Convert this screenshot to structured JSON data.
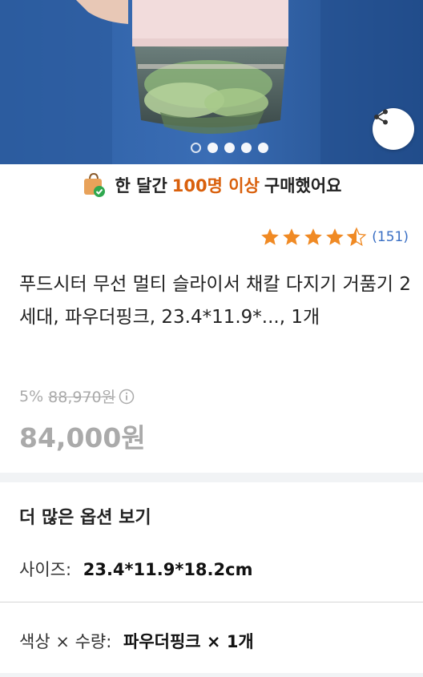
{
  "hero": {
    "share_icon": "share-icon",
    "carousel_dots": 5,
    "active_dot": 0
  },
  "banner": {
    "icon": "shopping-bag-check-icon",
    "prefix": "한 달간",
    "highlight": "100명 이상",
    "suffix": "구매했어요",
    "highlight_color": "#d9600c"
  },
  "rating": {
    "stars": 4.5,
    "review_count": "(151)",
    "star_color": "#f08a24",
    "link_color": "#3a6fc4"
  },
  "product": {
    "title": "푸드시터 무선 멀티 슬라이서 채칼 다지기 거품기 2세대, 파우더핑크, 23.4*11.9*..., 1개"
  },
  "price": {
    "discount_rate": "5%",
    "original_price": "88,970원",
    "sale_price": "84,000원"
  },
  "options": {
    "header": "더 많은 옵션 보기",
    "size_label": "사이즈:",
    "size_value": "23.4*11.9*18.2cm",
    "color_qty_label": "색상 × 수량:",
    "color_qty_value": "파우더핑크 × 1개"
  }
}
